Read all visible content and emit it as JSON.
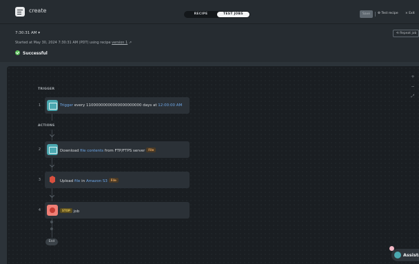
{
  "header": {
    "title": "create",
    "tabs": [
      {
        "label": "RECIPE",
        "active": false
      },
      {
        "label": "TEST JOBS",
        "active": true
      }
    ],
    "save_label": "Save",
    "test_recipe_label": "Test recipe",
    "exit_label": "Exit"
  },
  "job": {
    "time": "7:30:31 AM",
    "started_text": "Started at May 30, 2024 7:30:31 AM (PDT) using recipe",
    "version_link": "version 1",
    "status": "Successful",
    "repeat_label": "Repeat job"
  },
  "flow": {
    "trigger_label": "TRIGGER",
    "actions_label": "ACTIONS",
    "end_label": "End",
    "steps": [
      {
        "num": "1",
        "parts": {
          "a": "Trigger",
          "b": " every 11000000000000000000000 days at ",
          "c": "12:00:00 AM"
        }
      },
      {
        "num": "2",
        "parts": {
          "a": "Download ",
          "b": "file contents",
          "c": " from FTP/FTPS server ",
          "pill": "File"
        }
      },
      {
        "num": "3",
        "parts": {
          "a": "Upload ",
          "b": "file",
          "c": " in ",
          "d": "Amazon S3",
          "pill": "File"
        }
      },
      {
        "num": "4",
        "parts": {
          "pill": "STOP",
          "a": " job"
        }
      }
    ]
  },
  "zoom_controls": [
    "+",
    "−",
    "⤢"
  ],
  "assistant": {
    "label": "Assistant"
  },
  "colors": {
    "background": "#2c3339",
    "canvas": "#1a1e22",
    "success": "#5bc05a",
    "link": "#6fa8e8",
    "connector_icon": "#4ba8b0",
    "stop_icon": "#f07f76"
  },
  "icons": {
    "app": "recipe-icon",
    "trigger": "scheduler-icon",
    "download": "ftp-icon",
    "upload": "amazon-s3-icon",
    "stop": "stop-icon"
  }
}
